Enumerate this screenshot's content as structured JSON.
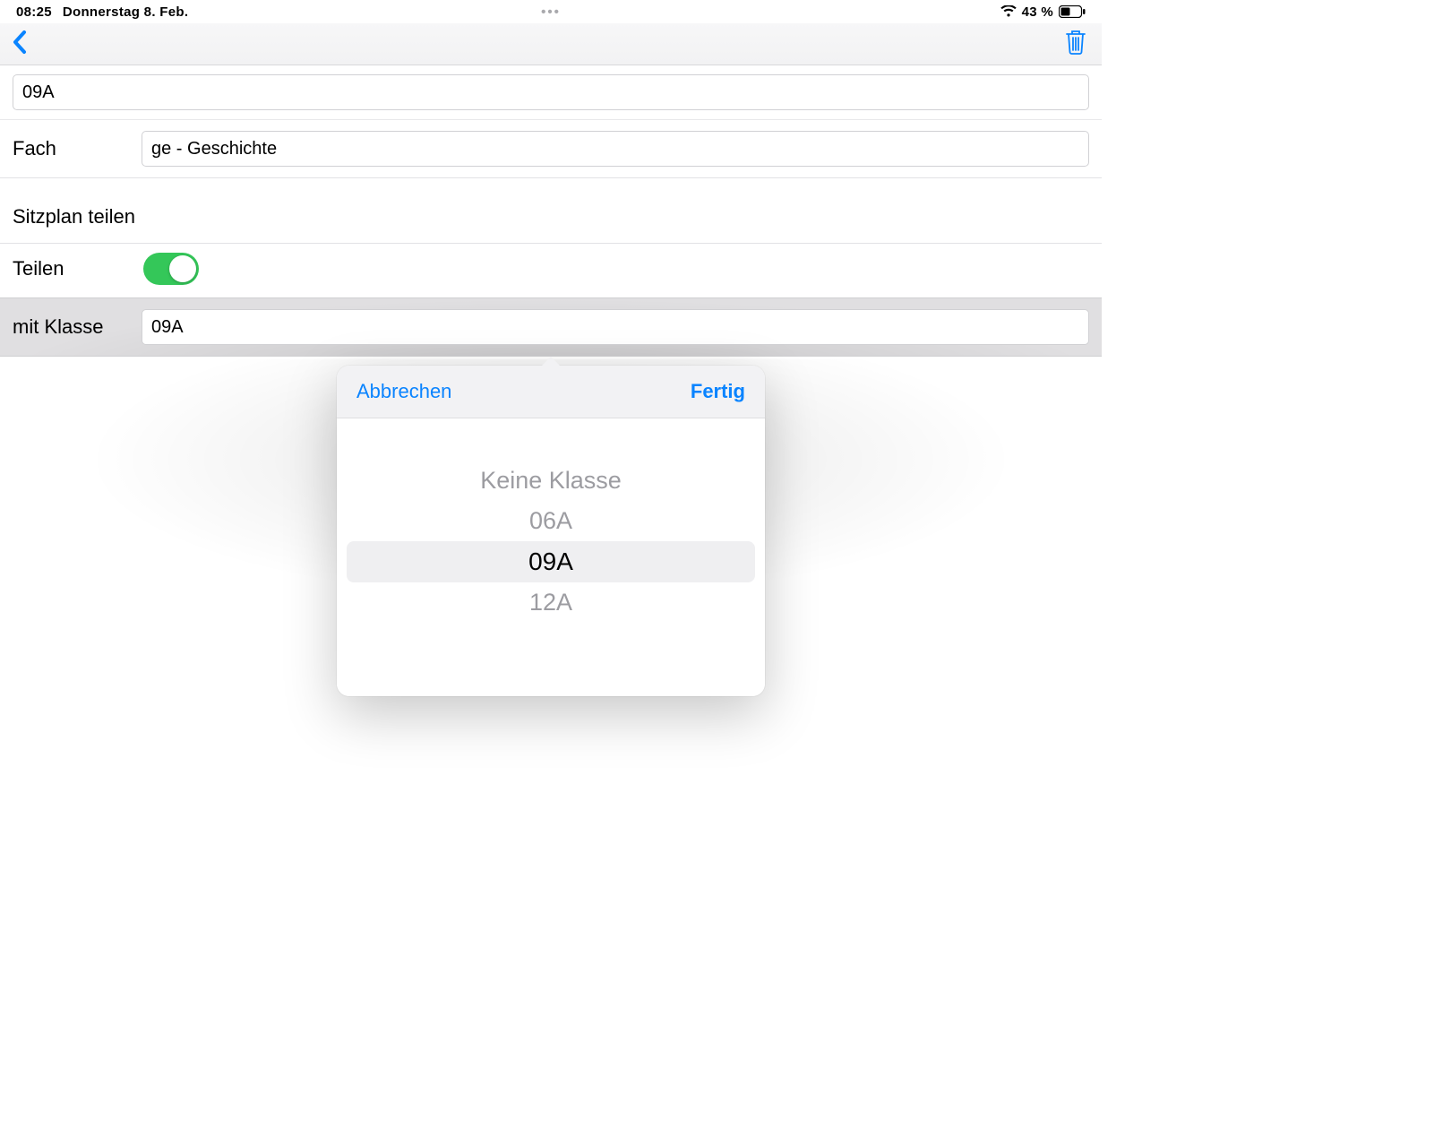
{
  "status_bar": {
    "time": "08:25",
    "date": "Donnerstag 8. Feb.",
    "multitask": "•••",
    "battery_pct": "43 %"
  },
  "form": {
    "class_value": "09A",
    "subject_label": "Fach",
    "subject_value": "ge - Geschichte",
    "seating_section": "Sitzplan teilen",
    "share_label": "Teilen",
    "share_on": true,
    "with_class_label": "mit Klasse",
    "with_class_value": "09A"
  },
  "popover": {
    "cancel": "Abbrechen",
    "done": "Fertig",
    "items": [
      "Keine Klasse",
      "06A",
      "09A",
      "12A"
    ],
    "selected": "09A"
  }
}
